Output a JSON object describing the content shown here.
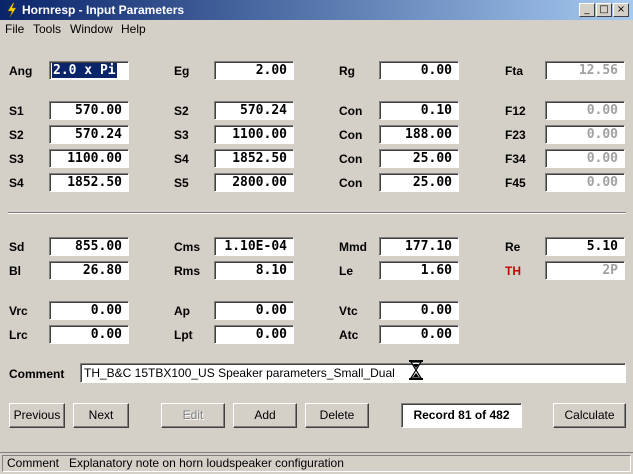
{
  "window": {
    "title": "Hornresp - Input Parameters",
    "controls": {
      "minimize": "_",
      "maximize": "□",
      "close": "×"
    }
  },
  "menu": [
    "File",
    "Tools",
    "Window",
    "Help"
  ],
  "fields": {
    "Ang": {
      "label": "Ang",
      "value": "2.0 x Pi"
    },
    "Eg": {
      "label": "Eg",
      "value": "2.00"
    },
    "Rg": {
      "label": "Rg",
      "value": "0.00"
    },
    "Fta": {
      "label": "Fta",
      "value": "12.56"
    },
    "S1a": {
      "label": "S1",
      "value": "570.00"
    },
    "S2a": {
      "label": "S2",
      "value": "570.24"
    },
    "S3a": {
      "label": "S3",
      "value": "1100.00"
    },
    "S4a": {
      "label": "S4",
      "value": "1852.50"
    },
    "S2b": {
      "label": "S2",
      "value": "570.24"
    },
    "S3b": {
      "label": "S3",
      "value": "1100.00"
    },
    "S4b": {
      "label": "S4",
      "value": "1852.50"
    },
    "S5b": {
      "label": "S5",
      "value": "2800.00"
    },
    "Con1": {
      "label": "Con",
      "value": "0.10"
    },
    "Con2": {
      "label": "Con",
      "value": "188.00"
    },
    "Con3": {
      "label": "Con",
      "value": "25.00"
    },
    "Con4": {
      "label": "Con",
      "value": "25.00"
    },
    "F12": {
      "label": "F12",
      "value": "0.00"
    },
    "F23": {
      "label": "F23",
      "value": "0.00"
    },
    "F34": {
      "label": "F34",
      "value": "0.00"
    },
    "F45": {
      "label": "F45",
      "value": "0.00"
    },
    "Sd": {
      "label": "Sd",
      "value": "855.00"
    },
    "Bl": {
      "label": "Bl",
      "value": "26.80"
    },
    "Cms": {
      "label": "Cms",
      "value": "1.10E-04"
    },
    "Rms": {
      "label": "Rms",
      "value": "8.10"
    },
    "Mmd": {
      "label": "Mmd",
      "value": "177.10"
    },
    "Le": {
      "label": "Le",
      "value": "1.60"
    },
    "Re": {
      "label": "Re",
      "value": "5.10"
    },
    "TH": {
      "label": "TH",
      "value": "2P"
    },
    "Vrc": {
      "label": "Vrc",
      "value": "0.00"
    },
    "Lrc": {
      "label": "Lrc",
      "value": "0.00"
    },
    "Ap": {
      "label": "Ap",
      "value": "0.00"
    },
    "Lpt": {
      "label": "Lpt",
      "value": "0.00"
    },
    "Vtc": {
      "label": "Vtc",
      "value": "0.00"
    },
    "Atc": {
      "label": "Atc",
      "value": "0.00"
    }
  },
  "comment": {
    "label": "Comment",
    "value": "TH_B&C 15TBX100_US Speaker parameters_Small_Dual"
  },
  "buttons": {
    "previous": "Previous",
    "next": "Next",
    "edit": "Edit",
    "add": "Add",
    "delete": "Delete",
    "calculate": "Calculate"
  },
  "record": "Record 81 of 482",
  "status": "Comment   Explanatory note on horn loudspeaker configuration",
  "colors": {
    "title_start": "#0a246a",
    "title_end": "#a6caf0",
    "highlight_label": "#cc0000",
    "readonly_text": "#a0a0a0"
  }
}
